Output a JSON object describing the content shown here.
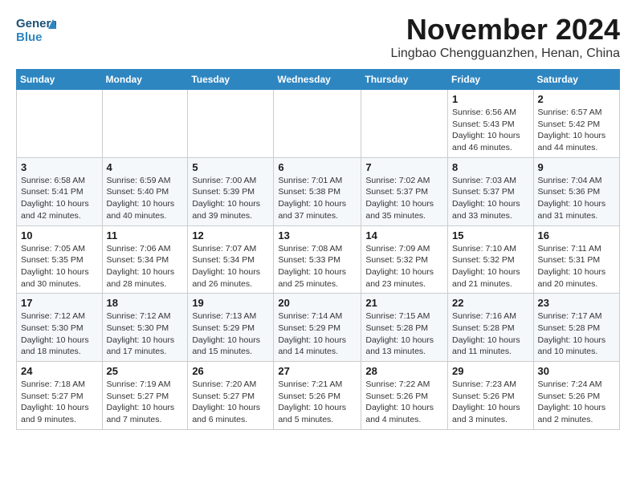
{
  "header": {
    "logo_general": "General",
    "logo_blue": "Blue",
    "month_year": "November 2024",
    "location": "Lingbao Chengguanzhen, Henan, China"
  },
  "columns": [
    "Sunday",
    "Monday",
    "Tuesday",
    "Wednesday",
    "Thursday",
    "Friday",
    "Saturday"
  ],
  "weeks": [
    {
      "days": [
        {
          "number": "",
          "info": ""
        },
        {
          "number": "",
          "info": ""
        },
        {
          "number": "",
          "info": ""
        },
        {
          "number": "",
          "info": ""
        },
        {
          "number": "",
          "info": ""
        },
        {
          "number": "1",
          "info": "Sunrise: 6:56 AM\nSunset: 5:43 PM\nDaylight: 10 hours and 46 minutes."
        },
        {
          "number": "2",
          "info": "Sunrise: 6:57 AM\nSunset: 5:42 PM\nDaylight: 10 hours and 44 minutes."
        }
      ]
    },
    {
      "days": [
        {
          "number": "3",
          "info": "Sunrise: 6:58 AM\nSunset: 5:41 PM\nDaylight: 10 hours and 42 minutes."
        },
        {
          "number": "4",
          "info": "Sunrise: 6:59 AM\nSunset: 5:40 PM\nDaylight: 10 hours and 40 minutes."
        },
        {
          "number": "5",
          "info": "Sunrise: 7:00 AM\nSunset: 5:39 PM\nDaylight: 10 hours and 39 minutes."
        },
        {
          "number": "6",
          "info": "Sunrise: 7:01 AM\nSunset: 5:38 PM\nDaylight: 10 hours and 37 minutes."
        },
        {
          "number": "7",
          "info": "Sunrise: 7:02 AM\nSunset: 5:37 PM\nDaylight: 10 hours and 35 minutes."
        },
        {
          "number": "8",
          "info": "Sunrise: 7:03 AM\nSunset: 5:37 PM\nDaylight: 10 hours and 33 minutes."
        },
        {
          "number": "9",
          "info": "Sunrise: 7:04 AM\nSunset: 5:36 PM\nDaylight: 10 hours and 31 minutes."
        }
      ]
    },
    {
      "days": [
        {
          "number": "10",
          "info": "Sunrise: 7:05 AM\nSunset: 5:35 PM\nDaylight: 10 hours and 30 minutes."
        },
        {
          "number": "11",
          "info": "Sunrise: 7:06 AM\nSunset: 5:34 PM\nDaylight: 10 hours and 28 minutes."
        },
        {
          "number": "12",
          "info": "Sunrise: 7:07 AM\nSunset: 5:34 PM\nDaylight: 10 hours and 26 minutes."
        },
        {
          "number": "13",
          "info": "Sunrise: 7:08 AM\nSunset: 5:33 PM\nDaylight: 10 hours and 25 minutes."
        },
        {
          "number": "14",
          "info": "Sunrise: 7:09 AM\nSunset: 5:32 PM\nDaylight: 10 hours and 23 minutes."
        },
        {
          "number": "15",
          "info": "Sunrise: 7:10 AM\nSunset: 5:32 PM\nDaylight: 10 hours and 21 minutes."
        },
        {
          "number": "16",
          "info": "Sunrise: 7:11 AM\nSunset: 5:31 PM\nDaylight: 10 hours and 20 minutes."
        }
      ]
    },
    {
      "days": [
        {
          "number": "17",
          "info": "Sunrise: 7:12 AM\nSunset: 5:30 PM\nDaylight: 10 hours and 18 minutes."
        },
        {
          "number": "18",
          "info": "Sunrise: 7:12 AM\nSunset: 5:30 PM\nDaylight: 10 hours and 17 minutes."
        },
        {
          "number": "19",
          "info": "Sunrise: 7:13 AM\nSunset: 5:29 PM\nDaylight: 10 hours and 15 minutes."
        },
        {
          "number": "20",
          "info": "Sunrise: 7:14 AM\nSunset: 5:29 PM\nDaylight: 10 hours and 14 minutes."
        },
        {
          "number": "21",
          "info": "Sunrise: 7:15 AM\nSunset: 5:28 PM\nDaylight: 10 hours and 13 minutes."
        },
        {
          "number": "22",
          "info": "Sunrise: 7:16 AM\nSunset: 5:28 PM\nDaylight: 10 hours and 11 minutes."
        },
        {
          "number": "23",
          "info": "Sunrise: 7:17 AM\nSunset: 5:28 PM\nDaylight: 10 hours and 10 minutes."
        }
      ]
    },
    {
      "days": [
        {
          "number": "24",
          "info": "Sunrise: 7:18 AM\nSunset: 5:27 PM\nDaylight: 10 hours and 9 minutes."
        },
        {
          "number": "25",
          "info": "Sunrise: 7:19 AM\nSunset: 5:27 PM\nDaylight: 10 hours and 7 minutes."
        },
        {
          "number": "26",
          "info": "Sunrise: 7:20 AM\nSunset: 5:27 PM\nDaylight: 10 hours and 6 minutes."
        },
        {
          "number": "27",
          "info": "Sunrise: 7:21 AM\nSunset: 5:26 PM\nDaylight: 10 hours and 5 minutes."
        },
        {
          "number": "28",
          "info": "Sunrise: 7:22 AM\nSunset: 5:26 PM\nDaylight: 10 hours and 4 minutes."
        },
        {
          "number": "29",
          "info": "Sunrise: 7:23 AM\nSunset: 5:26 PM\nDaylight: 10 hours and 3 minutes."
        },
        {
          "number": "30",
          "info": "Sunrise: 7:24 AM\nSunset: 5:26 PM\nDaylight: 10 hours and 2 minutes."
        }
      ]
    }
  ]
}
